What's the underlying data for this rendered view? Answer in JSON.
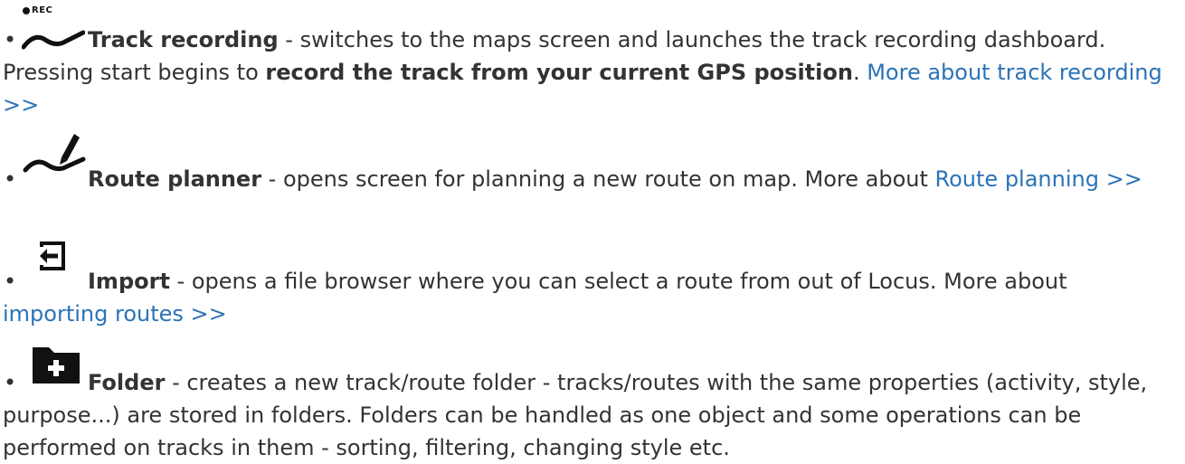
{
  "items": [
    {
      "icon": "track-recording-rec-icon",
      "badge": "REC",
      "title": "Track recording",
      "text_before": " - switches to the maps screen and launches the track recording dashboard. Pressing start begins to ",
      "bold_phrase": "record the track from your current GPS position",
      "text_after": ". ",
      "link": "More about track recording >>"
    },
    {
      "icon": "route-planner-pencil-icon",
      "title": "Route planner",
      "text": " - opens screen for planning a new route on map. More about ",
      "link": "Route planning >>"
    },
    {
      "icon": "import-icon",
      "title": "Import",
      "text": " - opens a file browser where you can select a route from out of Locus. More about ",
      "link": "importing routes >>"
    },
    {
      "icon": "add-folder-icon",
      "title": "Folder",
      "text": " - creates a new track/route folder - tracks/routes with the same properties (activity, style, purpose...) are stored in folders. Folders can be handled as one object and some operations can be performed on tracks in them - sorting, filtering, changing style etc."
    }
  ],
  "colors": {
    "text": "#333333",
    "link": "#2b73b7",
    "icon": "#111111"
  }
}
